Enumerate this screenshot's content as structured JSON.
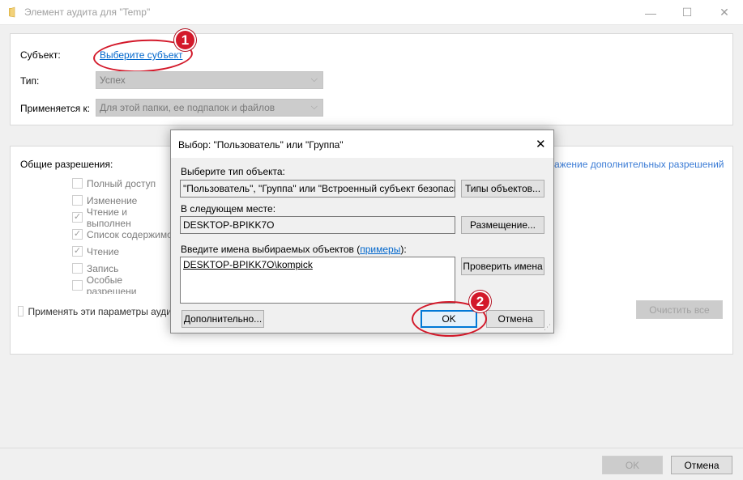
{
  "window": {
    "title": "Элемент аудита для \"Temp\"",
    "minimize": "—",
    "maximize": "☐",
    "close": "✕"
  },
  "top_panel": {
    "subject_label": "Субъект:",
    "subject_link": "Выберите субъект",
    "type_label": "Тип:",
    "type_value": "Успех",
    "applies_label": "Применяется к:",
    "applies_value": "Для этой папки, ее подпапок и файлов"
  },
  "permissions": {
    "heading": "Общие разрешения:",
    "show_advanced": "ажение дополнительных разрешений",
    "items": [
      {
        "label": "Полный доступ",
        "checked": false
      },
      {
        "label": "Изменение",
        "checked": false
      },
      {
        "label": "Чтение и выполнен",
        "checked": true
      },
      {
        "label": "Список содержимо",
        "checked": true
      },
      {
        "label": "Чтение",
        "checked": true
      },
      {
        "label": "Запись",
        "checked": false
      },
      {
        "label": "Особые разрешени",
        "checked": false
      }
    ],
    "apply_label": "Применять эти параметры ауди",
    "clear_all": "Очистить все"
  },
  "dialog": {
    "title": "Выбор: \"Пользователь\" или \"Группа\"",
    "object_type_label": "Выберите тип объекта:",
    "object_type_value": "\"Пользователь\", \"Группа\" или \"Встроенный субъект безопаснос",
    "object_types_button": "Типы объектов...",
    "location_label": "В следующем месте:",
    "location_value": "DESKTOP-BPIKK7O",
    "location_button": "Размещение...",
    "names_label_prefix": "Введите имена выбираемых объектов (",
    "names_label_link": "примеры",
    "names_label_suffix": "):",
    "names_value": "DESKTOP-BPIKK7O\\kompick",
    "check_names_button": "Проверить имена",
    "advanced_button": "Дополнительно...",
    "ok_button": "OK",
    "cancel_button": "Отмена"
  },
  "footer": {
    "ok_button": "OK",
    "cancel_button": "Отмена"
  },
  "annotations": {
    "badge1": "1",
    "badge2": "2",
    "color": "#d3192a"
  }
}
